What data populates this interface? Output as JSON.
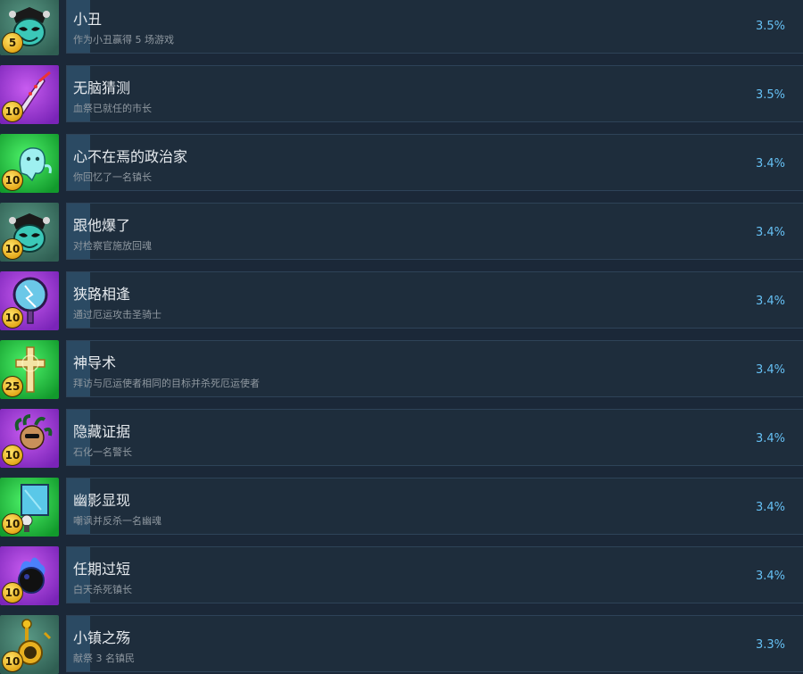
{
  "achievements": [
    {
      "title": "小丑",
      "desc": "作为小丑赢得 5 场游戏",
      "pct": "3.5%",
      "badge": "5",
      "icon": "jester-mask-icon",
      "bg": "teal"
    },
    {
      "title": "无脑猜测",
      "desc": "血祭已就任的市长",
      "pct": "3.5%",
      "badge": "10",
      "icon": "ritual-dagger-icon",
      "bg": "purple"
    },
    {
      "title": "心不在焉的政治家",
      "desc": "你回忆了一名镇长",
      "pct": "3.4%",
      "badge": "10",
      "icon": "ghost-spirit-icon",
      "bg": "green"
    },
    {
      "title": "跟他爆了",
      "desc": "对检察官施放回魂",
      "pct": "3.4%",
      "badge": "10",
      "icon": "jester-mask-icon",
      "bg": "teal"
    },
    {
      "title": "狭路相逢",
      "desc": "通过厄运攻击圣骑士",
      "pct": "3.4%",
      "badge": "10",
      "icon": "cracked-mirror-icon",
      "bg": "purple"
    },
    {
      "title": "神导术",
      "desc": "拜访与厄运使者相同的目标并杀死厄运使者",
      "pct": "3.4%",
      "badge": "25",
      "icon": "holy-cross-icon",
      "bg": "green"
    },
    {
      "title": "隐藏证据",
      "desc": "石化一名警长",
      "pct": "3.4%",
      "badge": "10",
      "icon": "medusa-head-icon",
      "bg": "purple"
    },
    {
      "title": "幽影显现",
      "desc": "嘲讽并反杀一名幽魂",
      "pct": "3.4%",
      "badge": "10",
      "icon": "haunted-portrait-icon",
      "bg": "green"
    },
    {
      "title": "任期过短",
      "desc": "白天杀死镇长",
      "pct": "3.4%",
      "badge": "10",
      "icon": "dark-orb-icon",
      "bg": "purple"
    },
    {
      "title": "小镇之殇",
      "desc": "献祭 3 名镇民",
      "pct": "3.3%",
      "badge": "10",
      "icon": "golden-scepter-icon",
      "bg": "teal"
    }
  ],
  "colors": {
    "background": "#1b2838",
    "card": "#1e2d3c",
    "progress": "#2b4a63",
    "percent": "#66c0f4"
  }
}
